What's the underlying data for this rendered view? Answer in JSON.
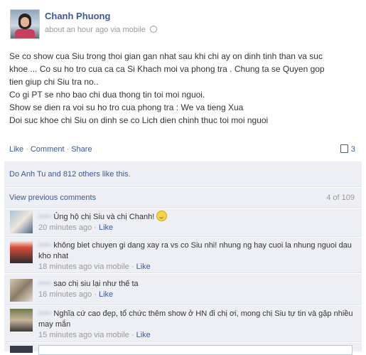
{
  "post": {
    "author": "Chanh Phuong",
    "meta": "about an hour ago via mobile",
    "message_lines": [
      "Se co show cua Siu trong thoi gian gan nhat sau khi chi ay on dinh tinh than va suc",
      "khoe ... Co su ho tro cua ca ca Si Khach moi va phong tra . Chung ta se Quyen gop",
      "tien giup chi Siu tra no..",
      "Co gi PT se nho bao chi dua thong tin toi moi nguoi.",
      "Show se dien ra voi su ho tro cua phong tra : We va tieng Xua",
      "Doi suc khoe chi Siu on dinh se co Lich dien chinh thuc toi moi nguoi"
    ],
    "actions": {
      "like": "Like",
      "comment": "Comment",
      "share": "Share",
      "sep": "·"
    },
    "share_count": "3"
  },
  "ufi": {
    "likes_text": "Do Anh Tu and 812 others like this.",
    "view_previous": "View previous comments",
    "pager": "4 of 109",
    "comments": [
      {
        "name": "·····",
        "text": "Ủng hộ chị Siu và chị Chanh!",
        "emoji": "smiley-icon",
        "time": "20 minutes ago",
        "via": "",
        "like": "Like"
      },
      {
        "name": "·····",
        "text": "không biet chuyen gi dang xay ra vs co Siu nhi! nhung ng hay cuoi la nhung nguoi dau kho nhat",
        "time": "18 minutes ago",
        "via": "via mobile",
        "like": "Like"
      },
      {
        "name": "·····",
        "text": "sao chị siu lại như thế ta",
        "time": "16 minutes ago",
        "via": "",
        "like": "Like"
      },
      {
        "name": "·····",
        "text": "Nghĩa cứ cao đẹp, tổ chức thêm show ở HN đi chị ơi, mong chị Siu tự tin và gặp nhiều may mắn",
        "time": "15 minutes ago",
        "via": "via mobile",
        "like": "Like"
      }
    ]
  }
}
